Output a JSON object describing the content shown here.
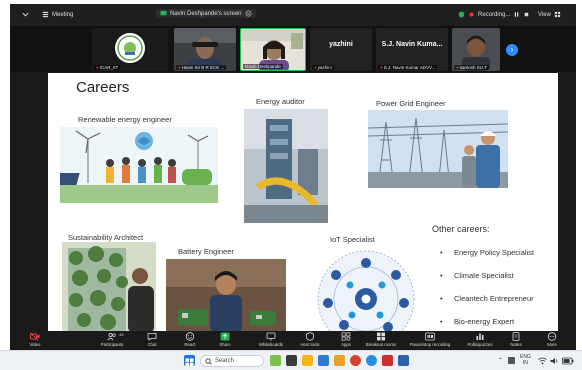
{
  "topbar": {
    "meeting_label": "Meeting",
    "share_label": "Navin Deshpande's screen",
    "recording_label": "Recording...",
    "view_label": "View"
  },
  "participants": [
    {
      "name": "ICAR_IIT",
      "label": ""
    },
    {
      "name": "Hansi Sri B R ECE ...",
      "label": ""
    },
    {
      "name": "Navin Deshpande",
      "label": ""
    },
    {
      "name": "yazhini",
      "label": "yazhini"
    },
    {
      "name": "S.J. Navin Kumar ADVV...",
      "label": "S.J. Navin Kuma..."
    },
    {
      "name": "santosh SU.T",
      "label": ""
    }
  ],
  "slide": {
    "title": "Careers",
    "careers": [
      "Renewable energy engineer",
      "Energy auditor",
      "Power Grid Engineer",
      "Sustainability Architect",
      "Battery Engineer",
      "IoT Specialist"
    ],
    "other_title": "Other careers:",
    "other_list": [
      "Energy Policy Specialist",
      "Climate Specialist",
      "Cleantech Entrepreneur",
      "Bio-energy Expert"
    ]
  },
  "toolbar": [
    {
      "label": "Video"
    },
    {
      "label": "Participants",
      "badge": "43"
    },
    {
      "label": "Chat"
    },
    {
      "label": "React"
    },
    {
      "label": "Share"
    },
    {
      "label": "Whiteboards"
    },
    {
      "label": "Host tools"
    },
    {
      "label": "Apps"
    },
    {
      "label": "Breakout rooms"
    },
    {
      "label": "Pause/stop recording"
    },
    {
      "label": "Polls/quizzes"
    },
    {
      "label": "Notes"
    },
    {
      "label": "More"
    }
  ],
  "taskbar": {
    "search_placeholder": "Search",
    "lang": "ENG",
    "lang_sub": "IN"
  }
}
